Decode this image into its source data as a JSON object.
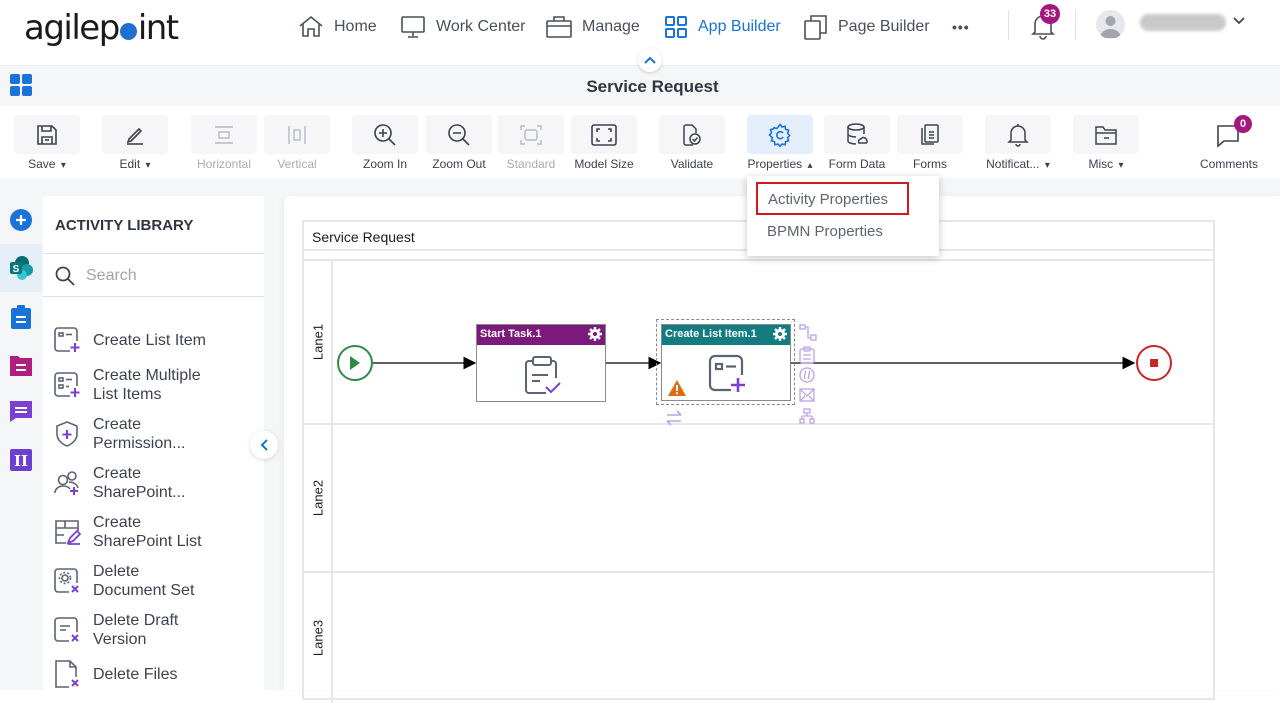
{
  "header": {
    "logo": {
      "prefix": "agilep",
      "suffix": "int"
    },
    "nav": [
      {
        "label": "Home",
        "icon": "home-icon"
      },
      {
        "label": "Work Center",
        "icon": "monitor-icon"
      },
      {
        "label": "Manage",
        "icon": "briefcase-icon"
      },
      {
        "label": "App Builder",
        "icon": "app-grid-icon",
        "active": true
      },
      {
        "label": "Page Builder",
        "icon": "pages-icon"
      }
    ],
    "more": "•••",
    "notifications_count": "33",
    "user_name": "(redacted)"
  },
  "titlebar": {
    "title": "Service Request"
  },
  "toolbar": {
    "items": [
      {
        "label": "Save",
        "dropdown": true
      },
      {
        "label": "Edit",
        "dropdown": true
      },
      {
        "label": "Horizontal",
        "disabled": true
      },
      {
        "label": "Vertical",
        "disabled": true
      },
      {
        "label": "Zoom In"
      },
      {
        "label": "Zoom Out"
      },
      {
        "label": "Standard",
        "disabled": true
      },
      {
        "label": "Model Size"
      },
      {
        "label": "Validate"
      },
      {
        "label": "Properties",
        "dropdown": true,
        "open": true
      },
      {
        "label": "Form Data"
      },
      {
        "label": "Forms"
      },
      {
        "label": "Notificat...",
        "dropdown": true
      },
      {
        "label": "Misc",
        "dropdown": true
      },
      {
        "label": "Comments",
        "badge": "0"
      }
    ],
    "caret_down": "❯",
    "caret_up": "❯"
  },
  "properties_menu": {
    "items": [
      "Activity Properties",
      "BPMN Properties"
    ],
    "highlighted": "Activity Properties"
  },
  "library": {
    "title": "ACTIVITY LIBRARY",
    "search_placeholder": "Search",
    "items": [
      {
        "lines": [
          "Create List Item"
        ]
      },
      {
        "lines": [
          "Create Multiple",
          "List Items"
        ]
      },
      {
        "lines": [
          "Create",
          "Permission..."
        ]
      },
      {
        "lines": [
          "Create",
          "SharePoint..."
        ]
      },
      {
        "lines": [
          "Create",
          "SharePoint List"
        ]
      },
      {
        "lines": [
          "Delete",
          "Document Set"
        ]
      },
      {
        "lines": [
          "Delete Draft",
          "Version"
        ]
      },
      {
        "lines": [
          "Delete Files"
        ]
      }
    ]
  },
  "canvas": {
    "pool_title": "Service Request",
    "lanes": [
      "Lane1",
      "Lane2",
      "Lane3"
    ],
    "tasks": [
      {
        "label": "Start Task.1",
        "color": "#7b1a7b"
      },
      {
        "label": "Create List Item.1",
        "color": "#127c80",
        "warning": true
      }
    ]
  },
  "colors": {
    "accent": "#1a73d8",
    "badge": "#a4177e",
    "start_event": "#2e8b45",
    "end_event": "#c62828",
    "highlight_border": "#d11a1a",
    "icon_purple": "#7b3fd4"
  }
}
